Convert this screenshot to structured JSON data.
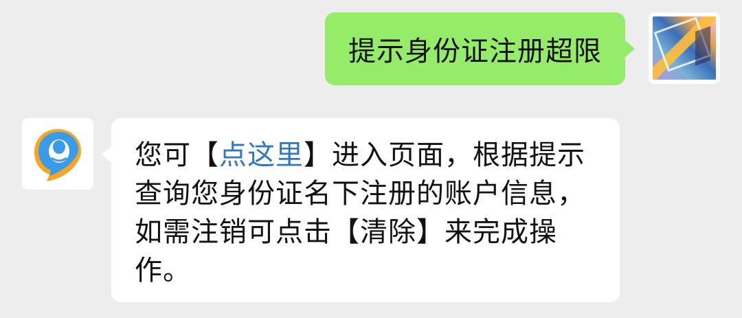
{
  "messages": [
    {
      "sender": "user",
      "text": "提示身份证注册超限"
    },
    {
      "sender": "qq-bot",
      "prefix": "您可【",
      "link": "点这里",
      "suffix": "】进入页面，根据提示查询您身份证名下注册的账户信息，如需注销可点击【清除】来完成操作。"
    }
  ],
  "colors": {
    "chat_background": "#ededed",
    "sent_bubble": "#95ec69",
    "received_bubble": "#ffffff",
    "link": "#2f76c5",
    "qq_blue": "#3a9bea",
    "qq_orange": "#f6a623"
  },
  "icons": {
    "user_avatar": "user-avatar-icon",
    "qq_avatar": "qq-penguin-icon"
  }
}
